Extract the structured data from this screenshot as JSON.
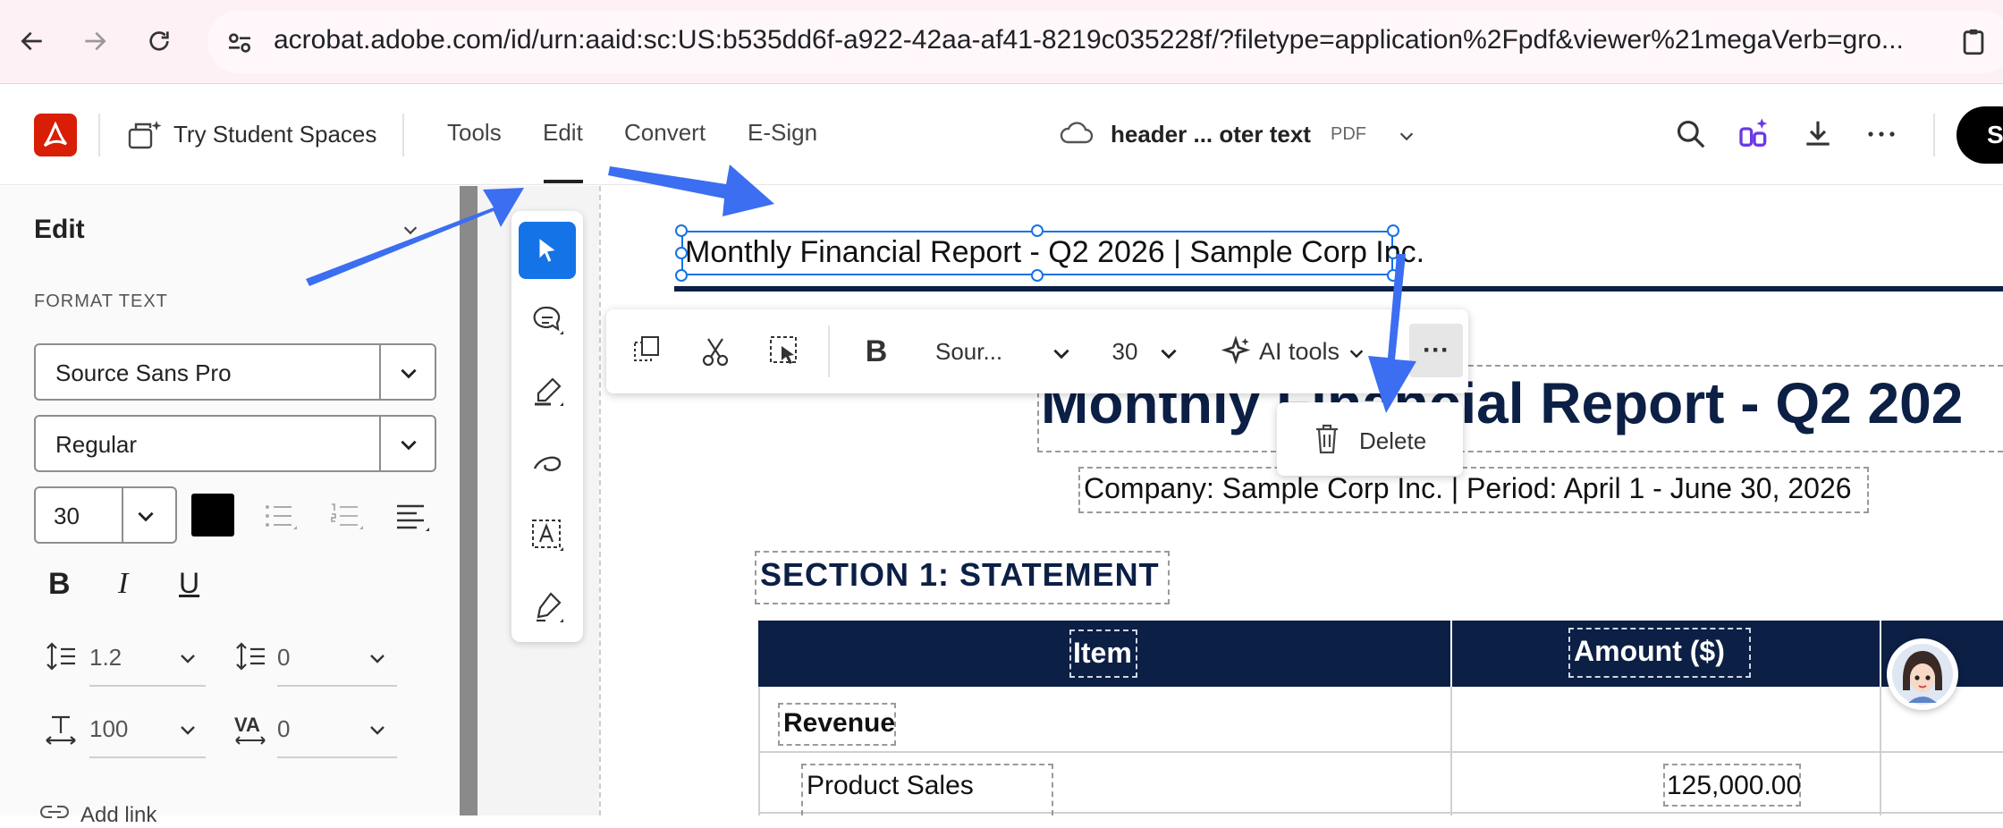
{
  "browser": {
    "url": "acrobat.adobe.com/id/urn:aaid:sc:US:b535dd6f-a922-42aa-af41-8219c035228f/?filetype=application%2Fpdf&viewer%21megaVerb=gro..."
  },
  "header": {
    "student_spaces_label": "Try Student Spaces",
    "menu": [
      "Tools",
      "Edit",
      "Convert",
      "E-Sign"
    ],
    "doc_name": "header ... oter text",
    "doc_type": "PDF",
    "sign_label": "S"
  },
  "left_panel": {
    "title": "Edit",
    "format_text_label": "FORMAT TEXT",
    "font_family": "Source Sans Pro",
    "font_style": "Regular",
    "font_size": "30",
    "bold": "B",
    "italic": "I",
    "underline": "U",
    "line_spacing": "1.2",
    "para_spacing": "0",
    "scale": "100",
    "char_spacing_label": "VA",
    "char_spacing": "0",
    "add_link": "Add link"
  },
  "float_toolbar": {
    "bold": "B",
    "font": "Sour...",
    "size": "30",
    "ai_tools": "AI tools",
    "more": "···"
  },
  "context_menu": {
    "delete": "Delete"
  },
  "document": {
    "header_text": "Monthly Financial Report - Q2 2026 | Sample Corp Inc.",
    "title": "Monthly Financial Report - Q2 202",
    "company": "Company: Sample Corp Inc. | Period: April 1 - June 30, 2026",
    "section": "SECTION 1:  STATEMENT",
    "table": {
      "headers": [
        "Item",
        "Amount ($)"
      ],
      "rows": [
        {
          "item": "Revenue",
          "amount": ""
        },
        {
          "item": "Product Sales",
          "amount": "125,000.00"
        }
      ]
    }
  },
  "colors": {
    "accent": "#1473e6",
    "navy": "#0c1f45",
    "adobe_red": "#d81e05",
    "annotation_arrow": "#3b6ef0"
  }
}
